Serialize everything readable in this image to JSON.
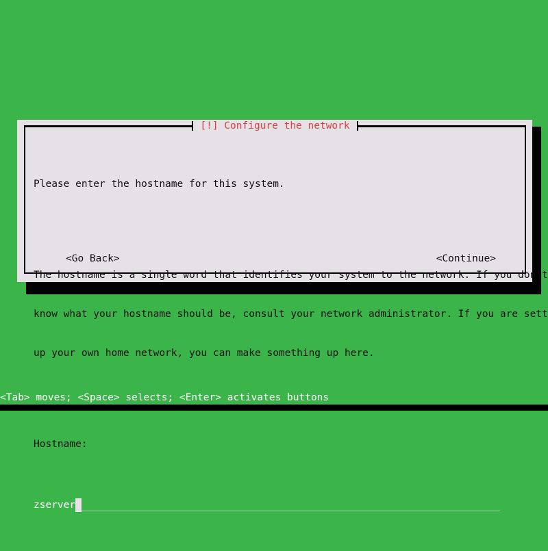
{
  "screen": {
    "background_color": "#3bb54a",
    "text_color": "#ffffff"
  },
  "dialog": {
    "title": "[!] Configure the network",
    "title_color": "#d94040",
    "background_color": "#e6e1e6",
    "border_color": "#000000",
    "intro_text": "Please enter the hostname for this system.",
    "description_lines": [
      "The hostname is a single word that identifies your system to the network. If you don't",
      "know what your hostname should be, consult your network administrator. If you are setting",
      "up your own home network, you can make something up here."
    ],
    "field": {
      "label": "Hostname:",
      "value": "zserver",
      "fill_character": "_",
      "fill_line": "______________________________________________________________________________",
      "highlight_color": "#3bb54a",
      "value_text_color": "#ffffff",
      "cursor_color": "#e6e1e6"
    },
    "buttons": {
      "back_label": "<Go Back>",
      "continue_label": "<Continue>"
    }
  },
  "status_bar": {
    "text": "<Tab> moves; <Space> selects; <Enter> activates buttons"
  }
}
